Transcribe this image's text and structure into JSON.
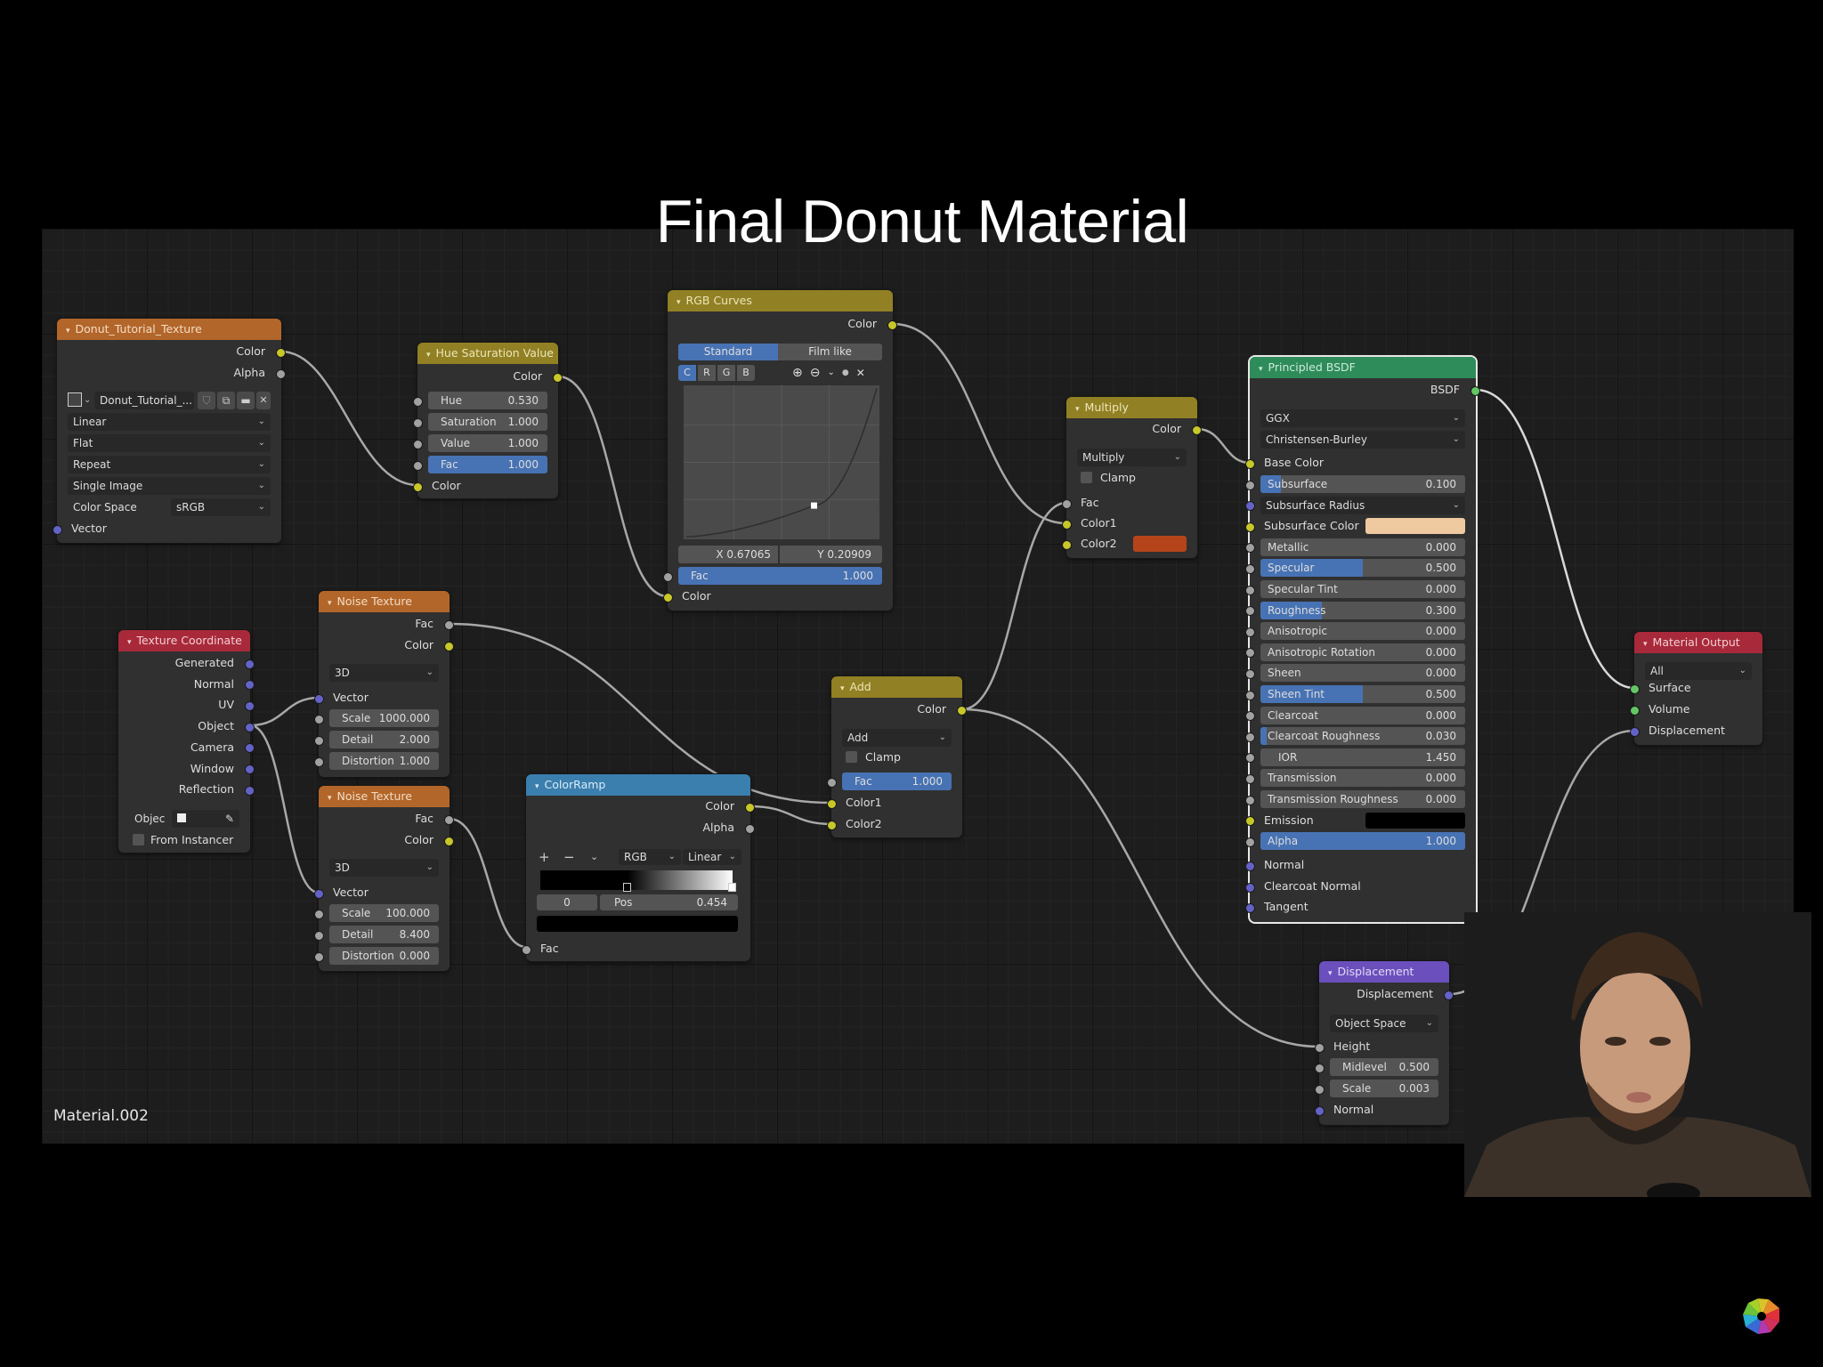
{
  "title": "Final Donut Material",
  "material_name": "Material.002",
  "colors": {
    "canvas_bg": "#1d1d1d",
    "header_texture": "#b3662a",
    "header_color": "#918124",
    "header_shader": "#2e8b5a",
    "header_output": "#a82a3a",
    "header_vector": "#6a4fbd",
    "header_converter": "#3a7fae",
    "slider_fill": "#4772b3",
    "socket_color": "#c7c729",
    "socket_float": "#a1a1a1",
    "socket_vector": "#6363c7",
    "socket_shader": "#63c763",
    "multiply_color2": "#b5441a",
    "subsurface_color": "#efcaa0",
    "emission_color": "#000000"
  },
  "nodes": {
    "image_texture": {
      "title": "Donut_Tutorial_Texture",
      "outputs": [
        "Color",
        "Alpha"
      ],
      "image_name": "Donut_Tutorial_...",
      "interpolation": "Linear",
      "projection": "Flat",
      "extension": "Repeat",
      "source": "Single Image",
      "color_space_label": "Color Space",
      "color_space": "sRGB",
      "inputs": [
        "Vector"
      ]
    },
    "hsv": {
      "title": "Hue Saturation Value",
      "output": "Color",
      "fields": [
        {
          "label": "Hue",
          "value": "0.530",
          "fraction": 0
        },
        {
          "label": "Saturation",
          "value": "1.000",
          "fraction": 0
        },
        {
          "label": "Value",
          "value": "1.000",
          "fraction": 0
        },
        {
          "label": "Fac",
          "value": "1.000",
          "fraction": 1
        }
      ],
      "input": "Color"
    },
    "rgb_curves": {
      "title": "RGB Curves",
      "output": "Color",
      "tabs": [
        "Standard",
        "Film like"
      ],
      "active_tab": "Standard",
      "channels": [
        "C",
        "R",
        "G",
        "B"
      ],
      "active_channel": "C",
      "point_x": "X 0.67065",
      "point_y": "Y 0.20909",
      "curve_points": [
        [
          0,
          0
        ],
        [
          0.67065,
          0.20909
        ],
        [
          1,
          1
        ]
      ],
      "fac_label": "Fac",
      "fac_value": "1.000",
      "input": "Color"
    },
    "multiply": {
      "title": "Multiply",
      "output": "Color",
      "blend_mode": "Multiply",
      "clamp_label": "Clamp",
      "inputs": [
        "Fac",
        "Color1",
        "Color2"
      ]
    },
    "principled": {
      "title": "Principled BSDF",
      "output": "BSDF",
      "distribution": "GGX",
      "subsurface_method": "Christensen-Burley",
      "base_color_label": "Base Color",
      "fields": [
        {
          "label": "Subsurface",
          "value": "0.100",
          "fraction": 0.1
        },
        {
          "label": "Subsurface Radius",
          "type": "dropdown"
        },
        {
          "label": "Subsurface Color",
          "type": "color"
        },
        {
          "label": "Metallic",
          "value": "0.000",
          "fraction": 0
        },
        {
          "label": "Specular",
          "value": "0.500",
          "fraction": 0.5
        },
        {
          "label": "Specular Tint",
          "value": "0.000",
          "fraction": 0
        },
        {
          "label": "Roughness",
          "value": "0.300",
          "fraction": 0.3
        },
        {
          "label": "Anisotropic",
          "value": "0.000",
          "fraction": 0
        },
        {
          "label": "Anisotropic Rotation",
          "value": "0.000",
          "fraction": 0
        },
        {
          "label": "Sheen",
          "value": "0.000",
          "fraction": 0
        },
        {
          "label": "Sheen Tint",
          "value": "0.500",
          "fraction": 0.5
        },
        {
          "label": "Clearcoat",
          "value": "0.000",
          "fraction": 0
        },
        {
          "label": "Clearcoat Roughness",
          "value": "0.030",
          "fraction": 0.03
        },
        {
          "label": "IOR",
          "value": "1.450",
          "fraction": 0
        },
        {
          "label": "Transmission",
          "value": "0.000",
          "fraction": 0
        },
        {
          "label": "Transmission Roughness",
          "value": "0.000",
          "fraction": 0
        },
        {
          "label": "Emission",
          "type": "color"
        },
        {
          "label": "Alpha",
          "value": "1.000",
          "fraction": 1
        }
      ],
      "vector_inputs": [
        "Normal",
        "Clearcoat Normal",
        "Tangent"
      ]
    },
    "material_output": {
      "title": "Material Output",
      "target": "All",
      "inputs": [
        "Surface",
        "Volume",
        "Displacement"
      ]
    },
    "texture_coordinate": {
      "title": "Texture Coordinate",
      "outputs": [
        "Generated",
        "Normal",
        "UV",
        "Object",
        "Camera",
        "Window",
        "Reflection"
      ],
      "object_label": "Objec",
      "from_instancer": "From Instancer"
    },
    "noise1": {
      "title": "Noise Texture",
      "outputs": [
        "Fac",
        "Color"
      ],
      "dimensions": "3D",
      "vector": "Vector",
      "fields": [
        {
          "label": "Scale",
          "value": "1000.000"
        },
        {
          "label": "Detail",
          "value": "2.000"
        },
        {
          "label": "Distortion",
          "value": "1.000"
        }
      ]
    },
    "noise2": {
      "title": "Noise Texture",
      "outputs": [
        "Fac",
        "Color"
      ],
      "dimensions": "3D",
      "vector": "Vector",
      "fields": [
        {
          "label": "Scale",
          "value": "100.000"
        },
        {
          "label": "Detail",
          "value": "8.400"
        },
        {
          "label": "Distortion",
          "value": "0.000"
        }
      ]
    },
    "colorramp": {
      "title": "ColorRamp",
      "outputs": [
        "Color",
        "Alpha"
      ],
      "add": "+",
      "remove": "−",
      "color_mode": "RGB",
      "interpolation": "Linear",
      "stop_index": "0",
      "pos_label": "Pos",
      "pos_value": "0.454",
      "stops": [
        0.454,
        1.0
      ],
      "input": "Fac"
    },
    "add": {
      "title": "Add",
      "output": "Color",
      "blend_mode": "Add",
      "clamp_label": "Clamp",
      "fac_label": "Fac",
      "fac_value": "1.000",
      "inputs": [
        "Color1",
        "Color2"
      ]
    },
    "displacement": {
      "title": "Displacement",
      "output": "Displacement",
      "space": "Object Space",
      "height": "Height",
      "fields": [
        {
          "label": "Midlevel",
          "value": "0.500"
        },
        {
          "label": "Scale",
          "value": "0.003"
        }
      ],
      "normal": "Normal"
    }
  },
  "webcam": {
    "description": "presenter-webcam"
  },
  "icons": {
    "collapse": "▾",
    "chevron": "⌄",
    "close": "✕",
    "zoom_in": "⊕",
    "zoom_out": "⊖",
    "eyedropper": "✎"
  }
}
